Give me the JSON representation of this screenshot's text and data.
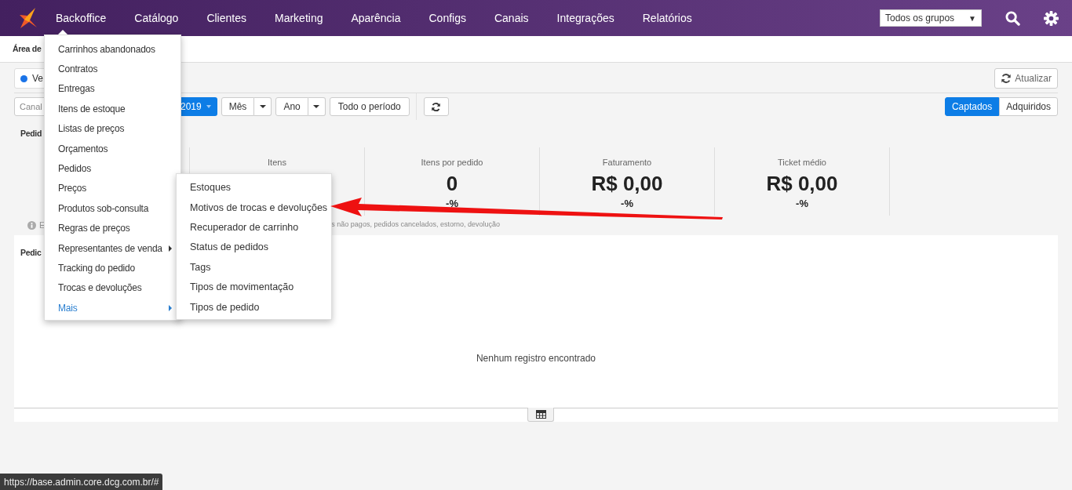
{
  "nav": {
    "items": [
      {
        "label": "Backoffice"
      },
      {
        "label": "Catálogo"
      },
      {
        "label": "Clientes"
      },
      {
        "label": "Marketing"
      },
      {
        "label": "Aparência"
      },
      {
        "label": "Configs"
      },
      {
        "label": "Canais"
      },
      {
        "label": "Integrações"
      },
      {
        "label": "Relatórios"
      }
    ],
    "group_select": {
      "value": "Todos os grupos",
      "arrow": "▼"
    }
  },
  "page": {
    "breadcrumb": "Área de",
    "channel_pill": "Ve",
    "refresh_button": "Atualizar",
    "channel_placeholder": "Canal",
    "year_button": "2019",
    "split_buttons": [
      "Mês",
      "Ano"
    ],
    "all_period_button": "Todo o período",
    "mode_toggle": [
      {
        "label": "Captados",
        "selected": true
      },
      {
        "label": "Adquiridos",
        "selected": false
      }
    ],
    "section_title": "Pedid",
    "stats": [
      {
        "label": "Itens"
      },
      {
        "label": "Itens por pedido",
        "value": "0",
        "change": "-%"
      },
      {
        "label": "Faturamento",
        "value": "R$ 0,00",
        "change": "-%"
      },
      {
        "label": "Ticket médio",
        "value": "R$ 0,00",
        "change": "-%"
      }
    ],
    "info_note_start": "E",
    "info_note_end": "s não pagos, pedidos cancelados, estorno, devolução",
    "table_title": "Pedic",
    "empty_message": "Nenhum registro encontrado"
  },
  "menu": {
    "items": [
      {
        "label": "Carrinhos abandonados",
        "submenu": false,
        "selected": false
      },
      {
        "label": "Contratos",
        "submenu": false,
        "selected": false
      },
      {
        "label": "Entregas",
        "submenu": false,
        "selected": false
      },
      {
        "label": "Itens de estoque",
        "submenu": false,
        "selected": false
      },
      {
        "label": "Listas de preços",
        "submenu": false,
        "selected": false
      },
      {
        "label": "Orçamentos",
        "submenu": false,
        "selected": false
      },
      {
        "label": "Pedidos",
        "submenu": false,
        "selected": false
      },
      {
        "label": "Preços",
        "submenu": false,
        "selected": false
      },
      {
        "label": "Produtos sob-consulta",
        "submenu": false,
        "selected": false
      },
      {
        "label": "Regras de preços",
        "submenu": false,
        "selected": false
      },
      {
        "label": "Representantes de venda",
        "submenu": true,
        "selected": false
      },
      {
        "label": "Tracking do pedido",
        "submenu": false,
        "selected": false
      },
      {
        "label": "Trocas e devoluções",
        "submenu": false,
        "selected": false
      },
      {
        "label": "Mais",
        "submenu": true,
        "selected": true
      }
    ]
  },
  "submenu": {
    "items": [
      "Estoques",
      "Motivos de trocas e devoluções",
      "Recuperador de carrinho",
      "Status de pedidos",
      "Tags",
      "Tipos de movimentação",
      "Tipos de pedido"
    ]
  },
  "status_bar": {
    "url": "https://base.admin.core.dcg.com.br/#"
  }
}
